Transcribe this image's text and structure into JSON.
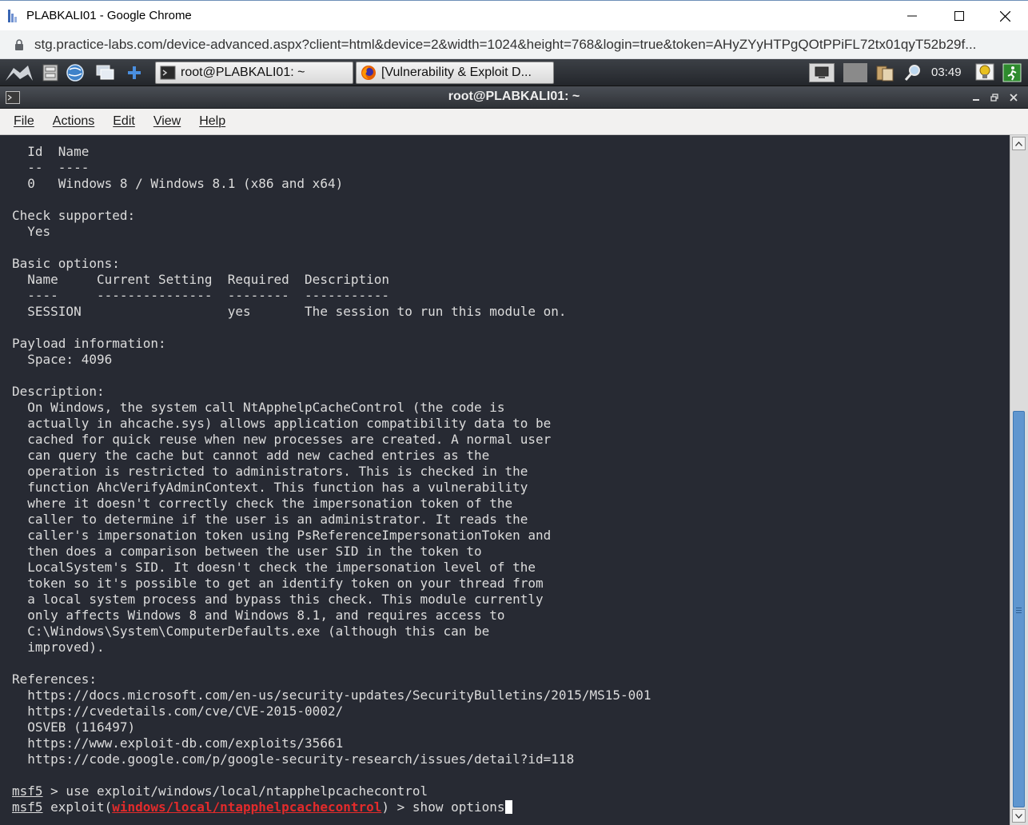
{
  "browser": {
    "window_title": "PLABKALI01 - Google Chrome",
    "url": "stg.practice-labs.com/device-advanced.aspx?client=html&device=2&width=1024&height=768&login=true&token=AHyZYyHTPgQOtPPiFL72tx01qyT52b29f..."
  },
  "panel": {
    "tasks": [
      {
        "label": "root@PLABKALI01: ~"
      },
      {
        "label": "[Vulnerability & Exploit D..."
      }
    ],
    "clock": "03:49"
  },
  "terminal_window": {
    "title": "root@PLABKALI01: ~",
    "menu": [
      "File",
      "Actions",
      "Edit",
      "View",
      "Help"
    ]
  },
  "terminal": {
    "lines": [
      "  Id  Name",
      "  --  ----",
      "  0   Windows 8 / Windows 8.1 (x86 and x64)",
      "",
      "Check supported:",
      "  Yes",
      "",
      "Basic options:",
      "  Name     Current Setting  Required  Description",
      "  ----     ---------------  --------  -----------",
      "  SESSION                   yes       The session to run this module on.",
      "",
      "Payload information:",
      "  Space: 4096",
      "",
      "Description:",
      "  On Windows, the system call NtApphelpCacheControl (the code is",
      "  actually in ahcache.sys) allows application compatibility data to be",
      "  cached for quick reuse when new processes are created. A normal user",
      "  can query the cache but cannot add new cached entries as the",
      "  operation is restricted to administrators. This is checked in the",
      "  function AhcVerifyAdminContext. This function has a vulnerability",
      "  where it doesn't correctly check the impersonation token of the",
      "  caller to determine if the user is an administrator. It reads the",
      "  caller's impersonation token using PsReferenceImpersonationToken and",
      "  then does a comparison between the user SID in the token to",
      "  LocalSystem's SID. It doesn't check the impersonation level of the",
      "  token so it's possible to get an identify token on your thread from",
      "  a local system process and bypass this check. This module currently",
      "  only affects Windows 8 and Windows 8.1, and requires access to",
      "  C:\\Windows\\System\\ComputerDefaults.exe (although this can be",
      "  improved).",
      "",
      "References:",
      "  https://docs.microsoft.com/en-us/security-updates/SecurityBulletins/2015/MS15-001",
      "  https://cvedetails.com/cve/CVE-2015-0002/",
      "  OSVEB (116497)",
      "  https://www.exploit-db.com/exploits/35661",
      "  https://code.google.com/p/google-security-research/issues/detail?id=118",
      ""
    ],
    "prompt1": {
      "prompt": "msf5",
      "command": " > use exploit/windows/local/ntapphelpcachecontrol"
    },
    "prompt2": {
      "prompt": "msf5",
      "pre": " exploit(",
      "module": "windows/local/ntapphelpcachecontrol",
      "post": ") > show options"
    }
  }
}
